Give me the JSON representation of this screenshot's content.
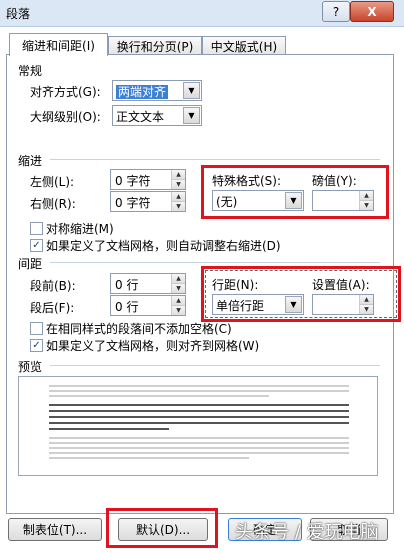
{
  "window": {
    "title": "段落",
    "help_label": "?",
    "close_label": "X"
  },
  "tabs": [
    {
      "label": "缩进和间距(I)",
      "active": true
    },
    {
      "label": "换行和分页(P)",
      "active": false
    },
    {
      "label": "中文版式(H)",
      "active": false
    }
  ],
  "general": {
    "section_label": "常规",
    "alignment_label": "对齐方式(G):",
    "alignment_value": "两端对齐",
    "outline_label": "大纲级别(O):",
    "outline_value": "正文文本"
  },
  "indent": {
    "section_label": "缩进",
    "left_label": "左侧(L):",
    "left_value": "0 字符",
    "right_label": "右侧(R):",
    "right_value": "0 字符",
    "special_label": "特殊格式(S):",
    "special_value": "(无)",
    "by_label": "磅值(Y):",
    "by_value": "",
    "mirror_label": "对称缩进(M)",
    "mirror_checked": false,
    "auto_right_label": "如果定义了文档网格，则自动调整右缩进(D)",
    "auto_right_checked": true
  },
  "spacing": {
    "section_label": "间距",
    "before_label": "段前(B):",
    "before_value": "0 行",
    "after_label": "段后(F):",
    "after_value": "0 行",
    "line_label": "行距(N):",
    "line_value": "单倍行距",
    "at_label": "设置值(A):",
    "at_value": "",
    "no_space_label": "在相同样式的段落间不添加空格(C)",
    "no_space_checked": false,
    "snap_grid_label": "如果定义了文档网格，则对齐到网格(W)",
    "snap_grid_checked": true
  },
  "preview": {
    "section_label": "预览"
  },
  "buttons": {
    "tabs_label": "制表位(T)...",
    "default_label": "默认(D)...",
    "ok_label": "确定",
    "cancel_label": "取消"
  },
  "watermark": "头条号 / 爱玩电脑",
  "colors": {
    "highlight_red": "#e0141e",
    "selection_blue": "#3c7fd6"
  }
}
